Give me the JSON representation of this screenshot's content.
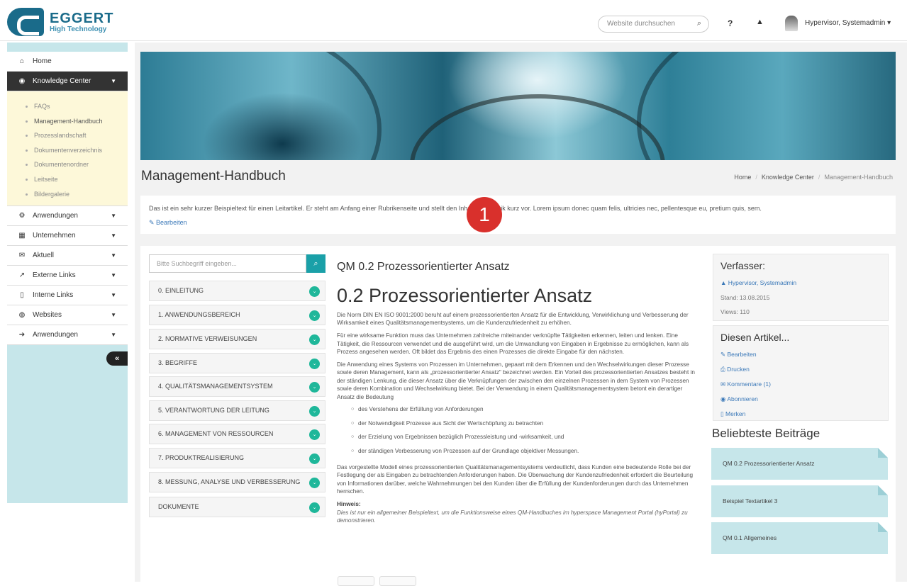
{
  "header": {
    "logo_title": "EGGERT",
    "logo_sub": "High Technology",
    "search_placeholder": "Website durchsuchen",
    "help": "?",
    "user": "Hypervisor, Systemadmin ▾"
  },
  "sidebar": {
    "items": [
      {
        "label": "Home",
        "icon": "home-icon",
        "glyph": "⌂"
      },
      {
        "label": "Knowledge Center",
        "icon": "lightbulb-icon",
        "glyph": "◉",
        "active": true
      },
      {
        "label": "Anwendungen",
        "icon": "cogs-icon",
        "glyph": "⚙"
      },
      {
        "label": "Unternehmen",
        "icon": "building-icon",
        "glyph": "▦"
      },
      {
        "label": "Aktuell",
        "icon": "megaphone-icon",
        "glyph": "✉"
      },
      {
        "label": "Externe Links",
        "icon": "external-link-icon",
        "glyph": "↗"
      },
      {
        "label": "Interne Links",
        "icon": "bookmark-icon",
        "glyph": "▯"
      },
      {
        "label": "Websites",
        "icon": "globe-icon",
        "glyph": "◍"
      },
      {
        "label": "Anwendungen",
        "icon": "sign-in-icon",
        "glyph": "➔"
      }
    ],
    "sub_items": [
      "FAQs",
      "Management-Handbuch",
      "Prozesslandschaft",
      "Dokumentenverzeichnis",
      "Dokumentenordner",
      "Leitseite",
      "Bildergalerie"
    ],
    "collapse": "«"
  },
  "page": {
    "title": "Management-Handbuch",
    "breadcrumb": [
      "Home",
      "Knowledge Center",
      "Management-Handbuch"
    ],
    "intro": "Das ist ein sehr kurzer Beispieltext für einen Leitartikel. Er steht am Anfang einer Rubrikenseite und stellt den Inhalt der Rubrik kurz vor. Lorem ipsum donec quam felis, ultricies nec, pellentesque eu, pretium quis, sem.",
    "intro_edit": "Bearbeiten",
    "badge": "1"
  },
  "accordion": {
    "search_placeholder": "Bitte Suchbegriff eingeben...",
    "items": [
      "0. EINLEITUNG",
      "1. ANWENDUNGSBEREICH",
      "2. NORMATIVE VERWEISUNGEN",
      "3. BEGRIFFE",
      "4. QUALITÄTSMANAGEMENTSYSTEM",
      "5. VERANTWORTUNG DER LEITUNG",
      "6. MANAGEMENT VON RESSOURCEN",
      "7. PRODUKTREALISIERUNG",
      "8. MESSUNG, ANALYSE UND VERBESSERUNG",
      "DOKUMENTE"
    ]
  },
  "article": {
    "small_title": "QM 0.2 Prozessorientierter Ansatz",
    "big_title": "0.2 Prozessorientierter Ansatz",
    "p1": "Die Norm DIN EN ISO 9001:2000 beruht auf einem prozessorientierten Ansatz für die Entwicklung, Verwirklichung und Verbesserung der Wirksamkeit eines Qualitätsmanagementsystems, um die Kundenzufriedenheit zu erhöhen.",
    "p2": "Für eine wirksame Funktion muss das Unternehmen zahlreiche miteinander verknüpfte Tätigkeiten erkennen, leiten und lenken. Eine Tätigkeit, die Ressourcen verwendet und die ausgeführt wird, um die Umwandlung von Eingaben in Ergebnisse zu ermöglichen, kann als Prozess angesehen werden. Oft bildet das Ergebnis des einen Prozesses die direkte Eingabe für den nächsten.",
    "p3": "Die Anwendung eines Systems von Prozessen im Unternehmen, gepaart mit dem Erkennen und den Wechselwirkungen dieser Prozesse sowie deren Management, kann als „prozessorientierter Ansatz\" bezeichnet werden. Ein Vorteil des prozessorientierten Ansatzes besteht in der ständigen Lenkung, die dieser Ansatz über die Verknüpfungen der zwischen den einzelnen Prozessen in dem System von Prozessen sowie deren Kombination und Wechselwirkung bietet. Bei der Verwendung in einem Qualitätsmanagementsystem betont ein derartiger Ansatz die Bedeutung",
    "bullets": [
      "des Verstehens der Erfüllung von Anforderungen",
      "der Notwendigkeit Prozesse aus Sicht der Wertschöpfung zu betrachten",
      "der Erzielung von Ergebnissen bezüglich Prozessleistung und -wirksamkeit, und",
      "der ständigen Verbesserung von Prozessen auf der Grundlage objektiver Messungen."
    ],
    "p4": "Das vorgestellte Modell eines prozessorientierten Qualitätsmanagementsystems verdeutlicht, dass Kunden eine bedeutende Rolle bei der Festlegung der als Eingaben zu betrachtenden Anforderungen haben. Die Überwachung der Kundenzufriedenheit erfordert die Beurteilung von Informationen darüber, welche Wahrnehmungen bei den Kunden über die Erfüllung der Kundenforderungen durch das Unternehmen herrschen.",
    "hint_title": "Hinweis:",
    "hint": "Dies ist nur ein allgemeiner Beispieltext, um die Funktionsweise eines QM-Handbuches im hyperspace Management Portal (hyPortal) zu demonstrieren."
  },
  "author_box": {
    "title": "Verfasser:",
    "name": "Hypervisor, Systemadmin",
    "date": "Stand: 13.08.2015",
    "views": "Views: 110"
  },
  "actions_box": {
    "title": "Diesen Artikel...",
    "links": [
      "Bearbeiten",
      "Drucken",
      "Kommentare (1)",
      "Abonnieren",
      "Merken"
    ]
  },
  "popular": {
    "title": "Beliebteste Beiträge",
    "items": [
      "QM 0.2 Prozessorientierter Ansatz",
      "Beispiel Textartikel 3",
      "QM 0.1 Allgemeines"
    ]
  }
}
